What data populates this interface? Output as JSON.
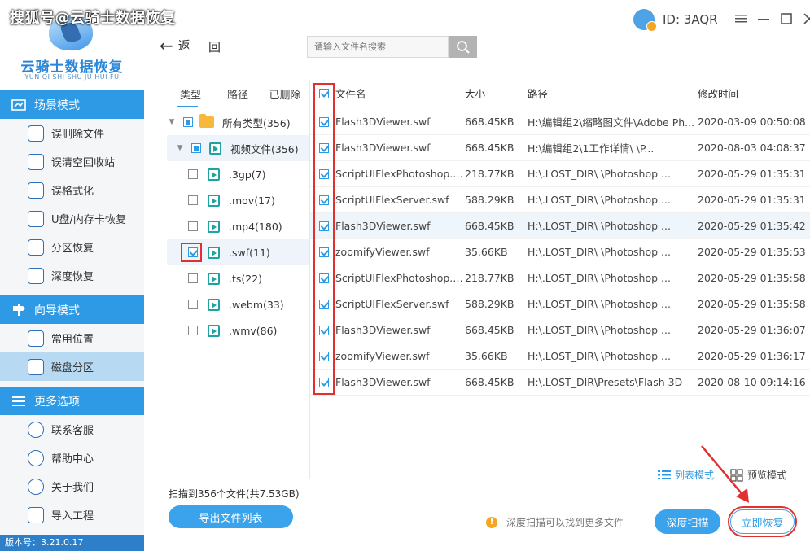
{
  "watermark": "搜狐号@云骑士数据恢复",
  "logo": {
    "title": "云骑士数据恢复",
    "subtitle": "YUN QI SHI SHU JU HUI FU"
  },
  "sidebar": {
    "sections": [
      {
        "title": "场景模式",
        "items": [
          "误删除文件",
          "误清空回收站",
          "误格式化",
          "U盘/内存卡恢复",
          "分区恢复",
          "深度恢复"
        ]
      },
      {
        "title": "向导模式",
        "items": [
          "常用位置",
          "磁盘分区"
        ]
      },
      {
        "title": "更多选项",
        "items": [
          "联系客服",
          "帮助中心",
          "关于我们",
          "导入工程"
        ]
      }
    ],
    "version": "版本号：3.21.0.17"
  },
  "topbar": {
    "back_label": "返",
    "home_label": "回",
    "search_placeholder": "请输入文件名搜索",
    "user_id": "ID: 3AQR"
  },
  "type_panel": {
    "tabs": [
      "类型",
      "路径",
      "已删除"
    ],
    "rows": [
      {
        "label": "所有类型(356)"
      },
      {
        "label": "视频文件(356)"
      },
      {
        "label": ".3gp(7)"
      },
      {
        "label": ".mov(17)"
      },
      {
        "label": ".mp4(180)"
      },
      {
        "label": ".swf(11)"
      },
      {
        "label": ".ts(22)"
      },
      {
        "label": ".webm(33)"
      },
      {
        "label": ".wmv(86)"
      }
    ]
  },
  "file_table": {
    "headers": {
      "name": "文件名",
      "size": "大小",
      "path": "路径",
      "time": "修改时间"
    },
    "rows": [
      {
        "name": "Flash3DViewer.swf",
        "size": "668.45KB",
        "path": "H:\\编辑组2\\缩略图文件\\Adobe Ph...",
        "time": "2020-03-09 00:50:08"
      },
      {
        "name": "Flash3DViewer.swf",
        "size": "668.45KB",
        "path": "H:\\编辑组2\\1工作详情\\        \\P...",
        "time": "2020-08-03 04:08:37"
      },
      {
        "name": "ScriptUIFlexPhotoshop.s...",
        "size": "218.77KB",
        "path": "H:\\.LOST_DIR\\        \\Photoshop ...",
        "time": "2020-05-29 01:35:31"
      },
      {
        "name": "ScriptUIFlexServer.swf",
        "size": "588.29KB",
        "path": "H:\\.LOST_DIR\\        \\Photoshop ...",
        "time": "2020-05-29 01:35:31"
      },
      {
        "name": "Flash3DViewer.swf",
        "size": "668.45KB",
        "path": "H:\\.LOST_DIR\\        \\Photoshop ...",
        "time": "2020-05-29 01:35:42"
      },
      {
        "name": "zoomifyViewer.swf",
        "size": "35.66KB",
        "path": "H:\\.LOST_DIR\\        \\Photoshop ...",
        "time": "2020-05-29 01:35:53"
      },
      {
        "name": "ScriptUIFlexPhotoshop.s...",
        "size": "218.77KB",
        "path": "H:\\.LOST_DIR\\        \\Photoshop ...",
        "time": "2020-05-29 01:35:58"
      },
      {
        "name": "ScriptUIFlexServer.swf",
        "size": "588.29KB",
        "path": "H:\\.LOST_DIR\\        \\Photoshop ...",
        "time": "2020-05-29 01:35:58"
      },
      {
        "name": "Flash3DViewer.swf",
        "size": "668.45KB",
        "path": "H:\\.LOST_DIR\\        \\Photoshop ...",
        "time": "2020-05-29 01:36:07"
      },
      {
        "name": "zoomifyViewer.swf",
        "size": "35.66KB",
        "path": "H:\\.LOST_DIR\\        \\Photoshop ...",
        "time": "2020-05-29 01:36:17"
      },
      {
        "name": "Flash3DViewer.swf",
        "size": "668.45KB",
        "path": "H:\\.LOST_DIR\\Presets\\Flash 3D",
        "time": "2020-08-10 09:14:16"
      }
    ]
  },
  "bottom": {
    "scan_summary": "扫描到356个文件(共7.53GB)",
    "export_label": "导出文件列表",
    "list_mode_label": "列表模式",
    "preview_mode_label": "预览模式",
    "deep_tip": "深度扫描可以找到更多文件",
    "deep_scan_label": "深度扫描",
    "recover_label": "立即恢复"
  },
  "colors": {
    "accent": "#2e9ae6",
    "highlight": "#e03030",
    "sidebar_active": "#b7d9f2"
  }
}
